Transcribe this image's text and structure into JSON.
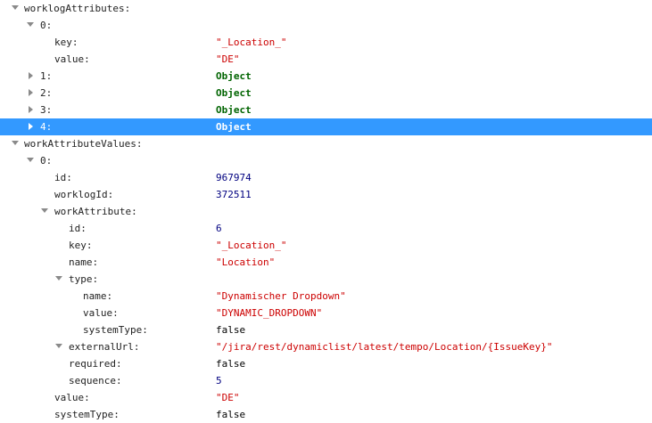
{
  "rows": [
    {
      "key": "worklogAttributes:",
      "value": "",
      "kind": "none",
      "twisty": "open"
    },
    {
      "key": "0:",
      "value": "",
      "kind": "none",
      "twisty": "open"
    },
    {
      "key": "key:",
      "value": "\"_Location_\"",
      "kind": "string",
      "twisty": "none"
    },
    {
      "key": "value:",
      "value": "\"DE\"",
      "kind": "string",
      "twisty": "none"
    },
    {
      "key": "1:",
      "value": "Object",
      "kind": "object",
      "twisty": "closed"
    },
    {
      "key": "2:",
      "value": "Object",
      "kind": "object",
      "twisty": "closed"
    },
    {
      "key": "3:",
      "value": "Object",
      "kind": "object",
      "twisty": "closed"
    },
    {
      "key": "4:",
      "value": "Object",
      "kind": "object",
      "twisty": "closed",
      "selected": true
    },
    {
      "key": "workAttributeValues:",
      "value": "",
      "kind": "none",
      "twisty": "open"
    },
    {
      "key": "0:",
      "value": "",
      "kind": "none",
      "twisty": "open"
    },
    {
      "key": "id:",
      "value": "967974",
      "kind": "number",
      "twisty": "none"
    },
    {
      "key": "worklogId:",
      "value": "372511",
      "kind": "number",
      "twisty": "none"
    },
    {
      "key": "workAttribute:",
      "value": "",
      "kind": "none",
      "twisty": "open"
    },
    {
      "key": "id:",
      "value": "6",
      "kind": "number",
      "twisty": "none"
    },
    {
      "key": "key:",
      "value": "\"_Location_\"",
      "kind": "string",
      "twisty": "none"
    },
    {
      "key": "name:",
      "value": "\"Location\"",
      "kind": "string",
      "twisty": "none"
    },
    {
      "key": "type:",
      "value": "",
      "kind": "none",
      "twisty": "open"
    },
    {
      "key": "name:",
      "value": "\"Dynamischer Dropdown\"",
      "kind": "string",
      "twisty": "none"
    },
    {
      "key": "value:",
      "value": "\"DYNAMIC_DROPDOWN\"",
      "kind": "string",
      "twisty": "none"
    },
    {
      "key": "systemType:",
      "value": "false",
      "kind": "bool",
      "twisty": "none"
    },
    {
      "key": "externalUrl:",
      "value": "\"/jira/rest/dynamiclist/latest/tempo/Location/{IssueKey}\"",
      "kind": "string",
      "twisty": "open"
    },
    {
      "key": "required:",
      "value": "false",
      "kind": "bool",
      "twisty": "none"
    },
    {
      "key": "sequence:",
      "value": "5",
      "kind": "number",
      "twisty": "none"
    },
    {
      "key": "value:",
      "value": "\"DE\"",
      "kind": "string",
      "twisty": "none"
    },
    {
      "key": "systemType:",
      "value": "false",
      "kind": "bool",
      "twisty": "none"
    }
  ]
}
